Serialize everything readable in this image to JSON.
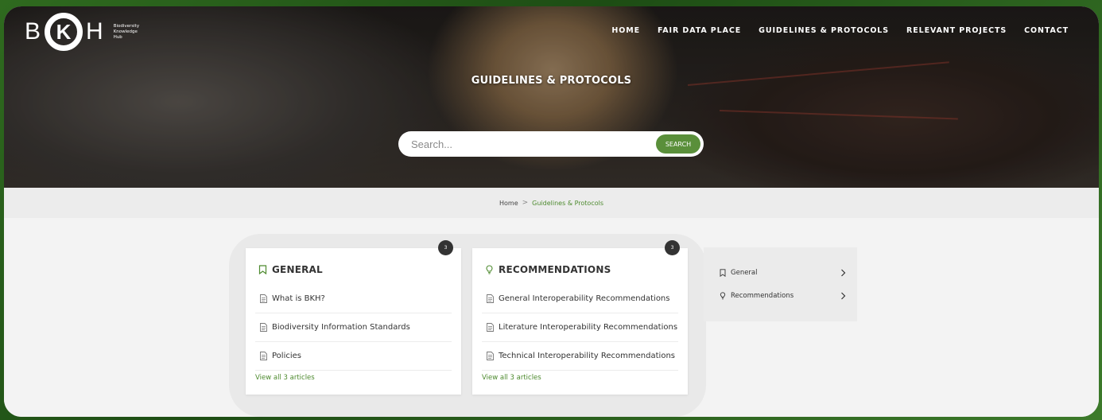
{
  "brand": {
    "letters": [
      "B",
      "K",
      "H"
    ],
    "tagline": [
      "Biodiversity",
      "Knowledge",
      "Hub"
    ]
  },
  "nav": {
    "items": [
      {
        "label": "HOME"
      },
      {
        "label": "FAIR DATA PLACE"
      },
      {
        "label": "GUIDELINES & PROTOCOLS"
      },
      {
        "label": "RELEVANT PROJECTS"
      },
      {
        "label": "CONTACT"
      }
    ]
  },
  "hero": {
    "title": "GUIDELINES & PROTOCOLS"
  },
  "search": {
    "placeholder": "Search...",
    "button_label": "SEARCH"
  },
  "breadcrumb": {
    "home": "Home",
    "separator": ">",
    "current": "Guidelines & Protocols"
  },
  "categories": [
    {
      "title": "GENERAL",
      "icon": "bookmark-icon",
      "count": "3",
      "articles": [
        "What is BKH?",
        "Biodiversity Information Standards",
        "Policies"
      ],
      "view_all": "View all 3 articles"
    },
    {
      "title": "RECOMMENDATIONS",
      "icon": "lightbulb-icon",
      "count": "3",
      "articles": [
        "General Interoperability Recommendations",
        "Literature Interoperability Recommendations",
        "Technical Interoperability Recommendations"
      ],
      "view_all": "View all 3 articles"
    }
  ],
  "sidebar": {
    "items": [
      {
        "label": "General",
        "icon": "bookmark-icon"
      },
      {
        "label": "Recommendations",
        "icon": "lightbulb-icon"
      }
    ]
  },
  "colors": {
    "accent": "#4d8a2e",
    "button": "#5a8f3a",
    "badge": "#333333"
  }
}
